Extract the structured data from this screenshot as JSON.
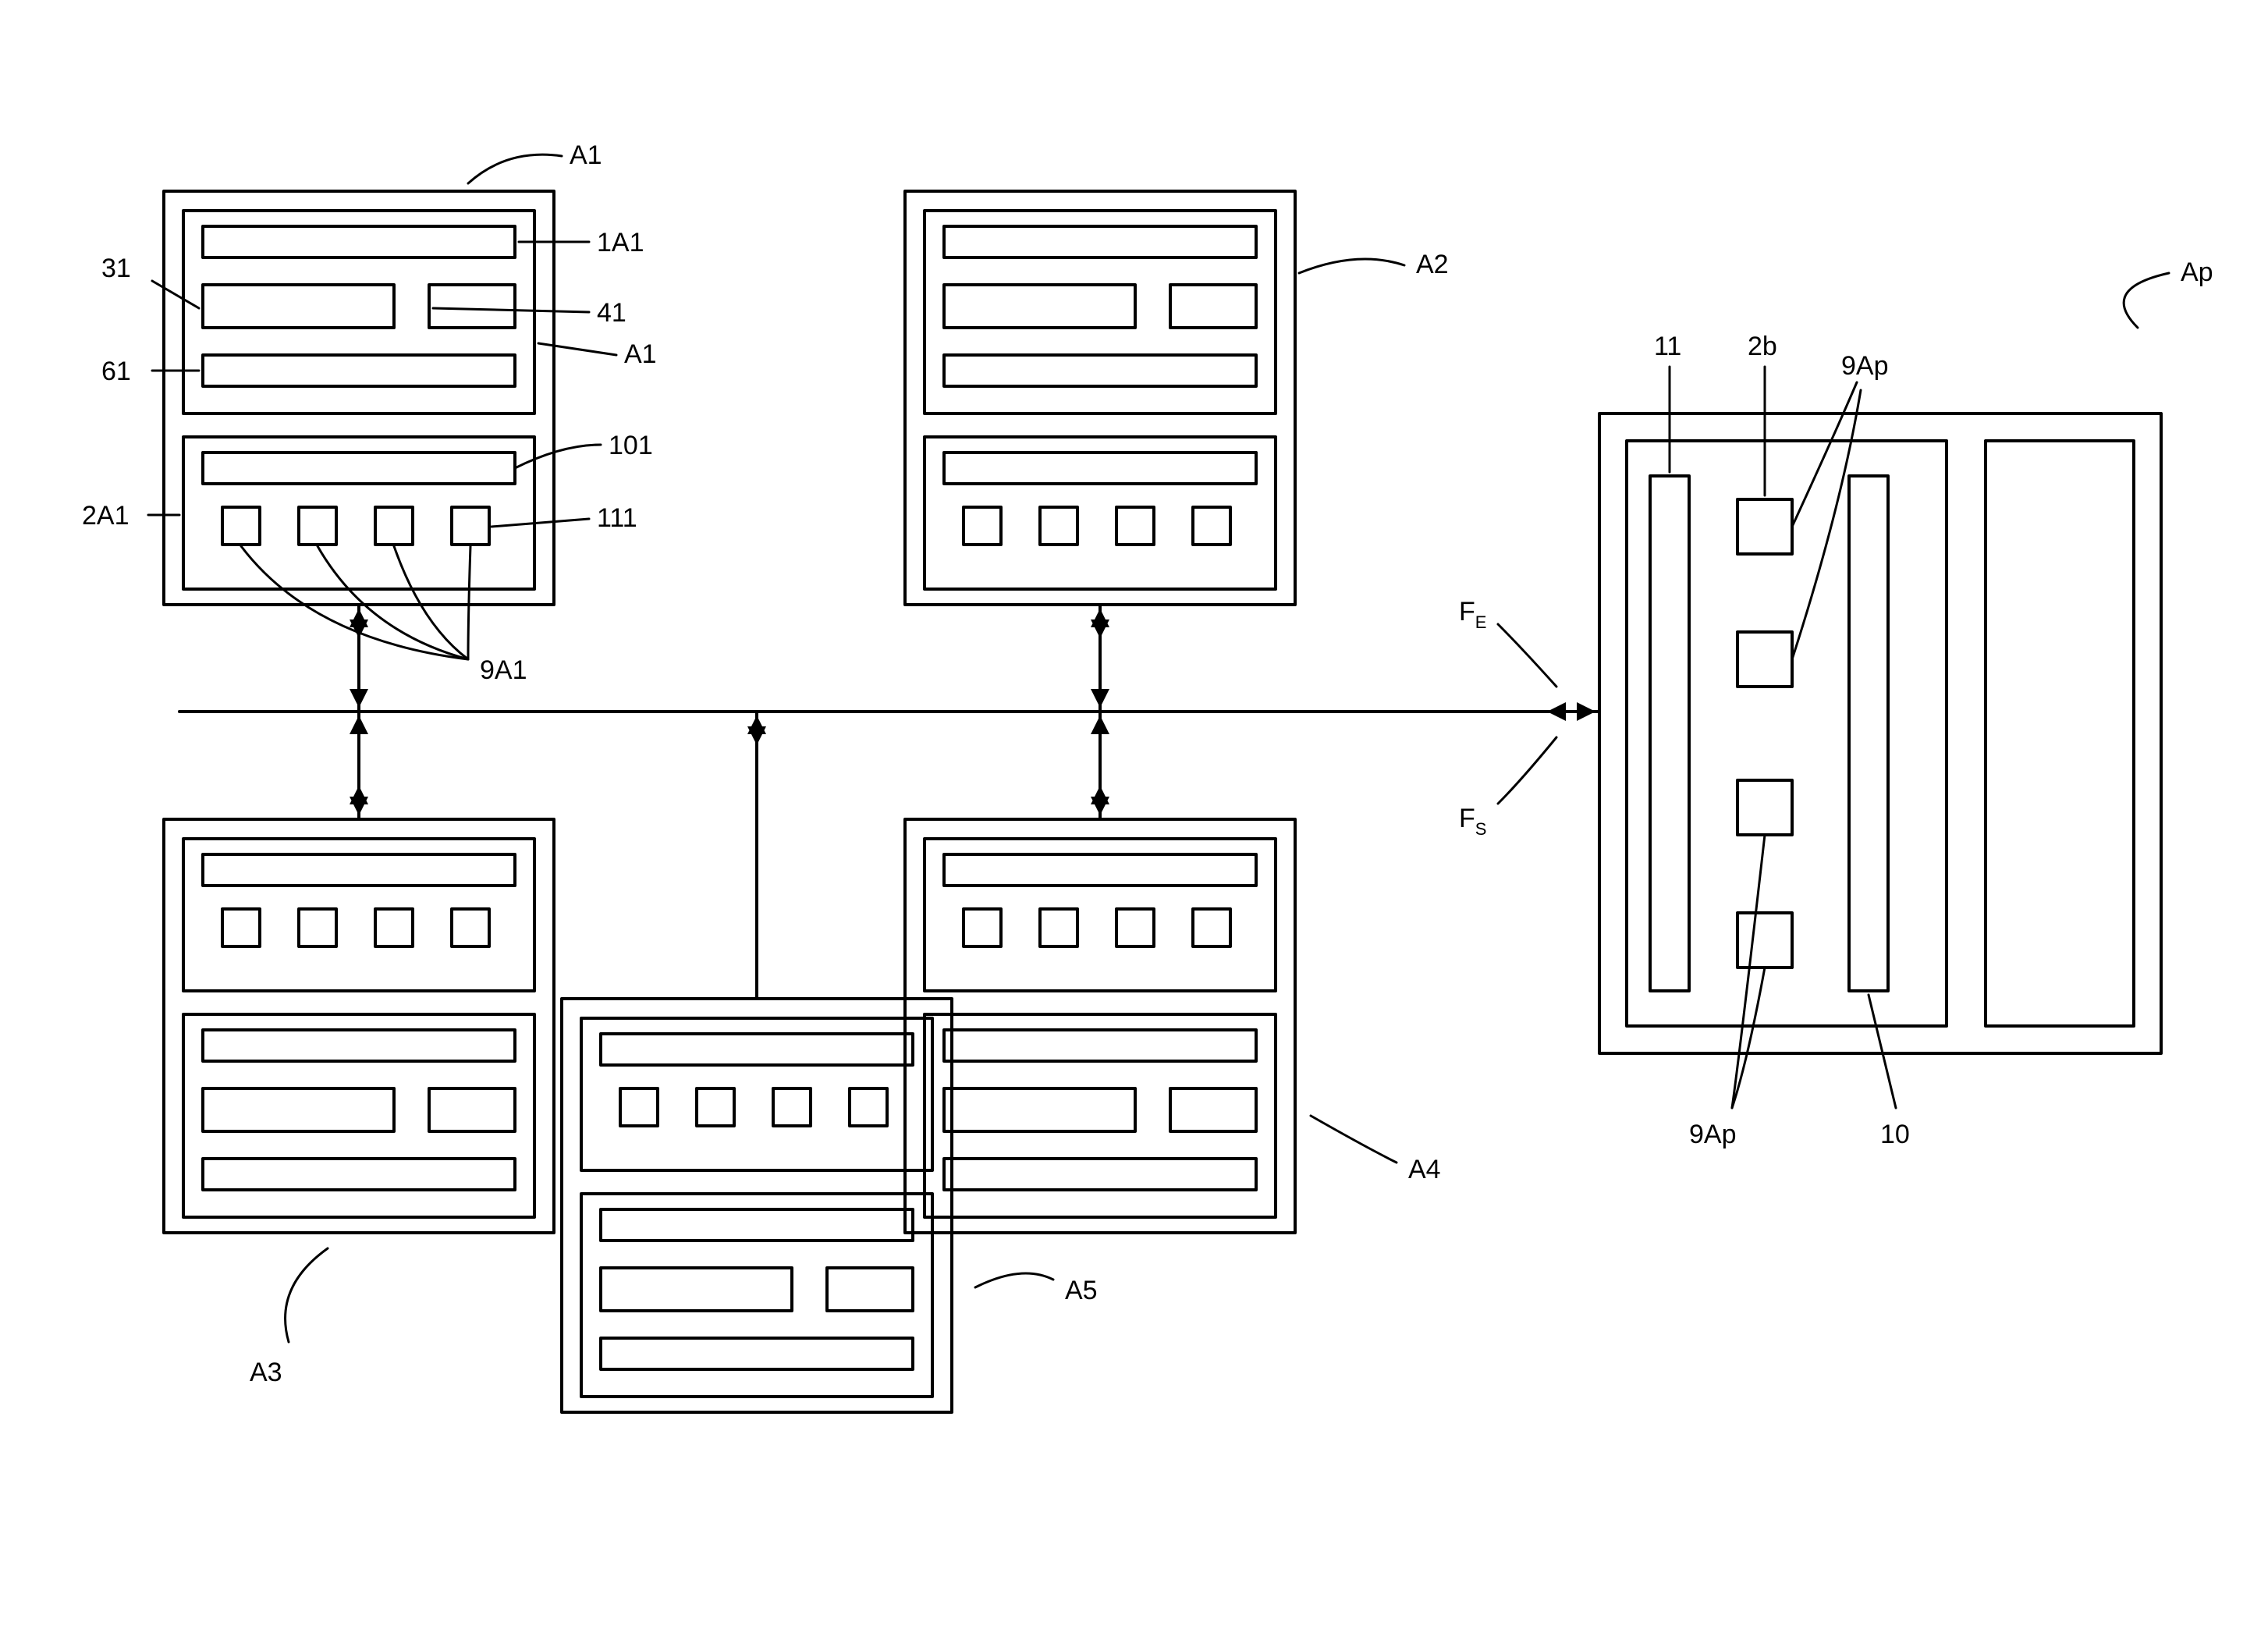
{
  "labels": {
    "A1_top": "A1",
    "A1_side": "A1",
    "l1A1": "1A1",
    "l31": "31",
    "l41": "41",
    "l61": "61",
    "l101": "101",
    "l2A1": "2A1",
    "l111": "111",
    "l9A1": "9A1",
    "A2": "A2",
    "A3": "A3",
    "A4": "A4",
    "A5": "A5",
    "Ap": "Ap",
    "l11": "11",
    "l2b": "2b",
    "l9Ap_top": "9Ap",
    "l9Ap_bottom": "9Ap",
    "l10": "10",
    "FE": "F",
    "FE_sub": "E",
    "FS": "F",
    "FS_sub": "S"
  }
}
